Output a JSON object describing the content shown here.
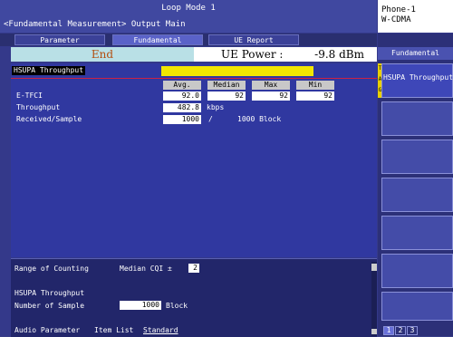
{
  "title": {
    "mode": "Loop Mode 1",
    "subtitle": "<Fundamental Measurement> Output Main"
  },
  "phone": {
    "line1": "Phone-1",
    "line2": "W-CDMA"
  },
  "tabs": [
    {
      "label": "Parameter",
      "active": false
    },
    {
      "label": "Fundamental",
      "active": true
    },
    {
      "label": "UE Report",
      "active": false
    }
  ],
  "status": {
    "end": "End",
    "ue_power_label": "UE Power :",
    "ue_power_value": "-9.8 dBm"
  },
  "main": {
    "section_title": "HSUPA Throughput",
    "columns": [
      "Avg.",
      "Median",
      "Max",
      "Min"
    ],
    "rows": [
      {
        "label": "E-TFCI",
        "avg": "92.0",
        "median": "92",
        "max": "92",
        "min": "92"
      },
      {
        "label": "Throughput",
        "avg": "482.8",
        "unit": "kbps"
      },
      {
        "label": "Received/Sample",
        "avg": "1000",
        "sep": "/",
        "total": "1000 Block"
      }
    ]
  },
  "bottom": {
    "range_label": "Range of Counting",
    "median_cqi_label": "Median CQI ±",
    "median_cqi_value": "2",
    "hsupa_label": "HSUPA Throughput",
    "samples_label": "Number of Sample",
    "samples_value": "1000",
    "samples_unit": "Block",
    "audio_label": "Audio Parameter",
    "item_list_label": "Item List",
    "item_list_value": "Standard"
  },
  "softkeys": {
    "header": "Fundamental",
    "side_letters": [
      "T",
      "A",
      "G"
    ],
    "keys": [
      "HSUPA Throughput",
      "",
      "",
      "",
      "",
      "",
      ""
    ],
    "pages": [
      "1",
      "2",
      "3"
    ]
  }
}
